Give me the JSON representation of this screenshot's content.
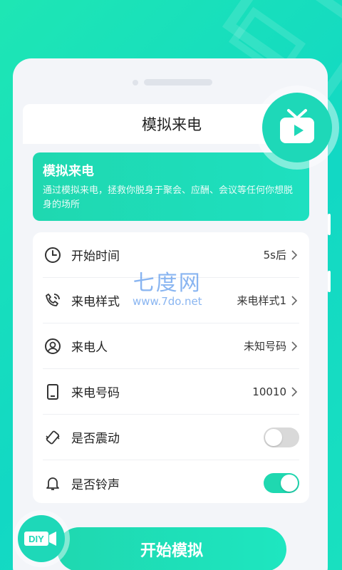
{
  "screen": {
    "title": "模拟来电"
  },
  "banner": {
    "title": "模拟来电",
    "description": "通过模拟来电，拯救你脱身于聚会、应酬、会议等任何你想脱身的场所"
  },
  "settings": [
    {
      "label": "开始时间",
      "value": "5s后",
      "icon": "clock-icon"
    },
    {
      "label": "来电样式",
      "value": "来电样式1",
      "icon": "phone-call-icon"
    },
    {
      "label": "来电人",
      "value": "未知号码",
      "icon": "person-icon"
    },
    {
      "label": "来电号码",
      "value": "10010",
      "icon": "mobile-phone-icon"
    },
    {
      "label": "是否震动",
      "toggle": false,
      "icon": "vibrate-icon"
    },
    {
      "label": "是否铃声",
      "toggle": true,
      "icon": "bell-icon"
    }
  ],
  "watermark": {
    "big": "七度网",
    "small": "www.7do.net"
  },
  "start_button": {
    "label": "开始模拟"
  },
  "diy_badge": {
    "label": "DIY"
  },
  "colors": {
    "accent": "#1fd8b0",
    "background": "#f3f5f9"
  }
}
